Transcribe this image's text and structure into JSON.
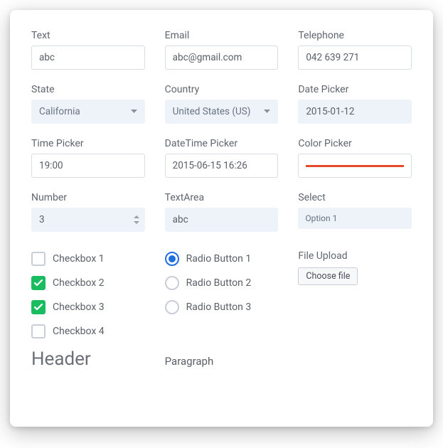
{
  "fields": {
    "text": {
      "label": "Text",
      "value": "abc"
    },
    "email": {
      "label": "Email",
      "value": "abc@gmail.com"
    },
    "telephone": {
      "label": "Telephone",
      "value": "042 639 271"
    },
    "state": {
      "label": "State",
      "value": "California"
    },
    "country": {
      "label": "Country",
      "value": "United States (US)"
    },
    "date_picker": {
      "label": "Date Picker",
      "value": "2015-01-12"
    },
    "time_picker": {
      "label": "Time Picker",
      "value": "19:00"
    },
    "datetime": {
      "label": "DateTime Picker",
      "value": "2015-06-15 16:26"
    },
    "color": {
      "label": "Color Picker",
      "value": "#e14b2a"
    },
    "number": {
      "label": "Number",
      "value": "3"
    },
    "textarea": {
      "label": "TextArea",
      "value": "abc"
    },
    "select": {
      "label": "Select",
      "value": "Option 1"
    }
  },
  "checkboxes": [
    {
      "label": "Checkbox 1",
      "checked": false
    },
    {
      "label": "Checkbox 2",
      "checked": true
    },
    {
      "label": "Checkbox 3",
      "checked": true
    },
    {
      "label": "Checkbox 4",
      "checked": false
    }
  ],
  "radios": [
    {
      "label": "Radio Button 1",
      "checked": true
    },
    {
      "label": "Radio Button 2",
      "checked": false
    },
    {
      "label": "Radio Button 3",
      "checked": false
    }
  ],
  "file_upload": {
    "label": "File Upload",
    "button": "Choose file"
  },
  "footer": {
    "header": "Header",
    "paragraph": "Paragraph"
  }
}
